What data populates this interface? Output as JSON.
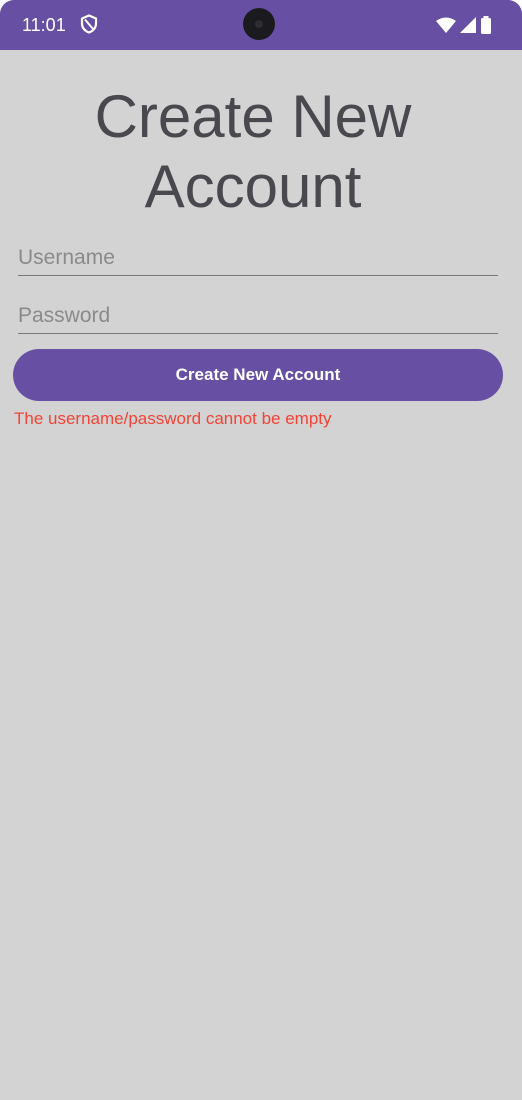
{
  "status_bar": {
    "time": "11:01",
    "color": "#6750a4"
  },
  "screen": {
    "title": "Create New Account",
    "username": {
      "placeholder": "Username",
      "value": ""
    },
    "password": {
      "placeholder": "Password",
      "value": ""
    },
    "create_button_label": "Create New Account",
    "error_message": "The username/password cannot be empty",
    "error_color": "#f44336",
    "background_color": "#d3d3d3"
  }
}
